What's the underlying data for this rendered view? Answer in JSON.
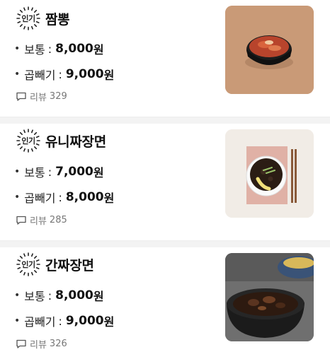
{
  "items": [
    {
      "badge": "인기",
      "name": "짬뽕",
      "prices": [
        {
          "label": "보통",
          "price": "8,000",
          "unit": "원"
        },
        {
          "label": "곱빼기",
          "price": "9,000",
          "unit": "원"
        }
      ],
      "review_label": "리뷰",
      "review_count": "329",
      "image": "jjamppong-photo",
      "image_bg": "#c99a77"
    },
    {
      "badge": "인기",
      "name": "유니짜장면",
      "prices": [
        {
          "label": "보통",
          "price": "7,000",
          "unit": "원"
        },
        {
          "label": "곱빼기",
          "price": "8,000",
          "unit": "원"
        }
      ],
      "review_label": "리뷰",
      "review_count": "285",
      "image": "yuni-jjajangmyeon-photo",
      "image_bg": "#f1ece6"
    },
    {
      "badge": "인기",
      "name": "간짜장면",
      "prices": [
        {
          "label": "보통",
          "price": "8,000",
          "unit": "원"
        },
        {
          "label": "곱빼기",
          "price": "9,000",
          "unit": "원"
        }
      ],
      "review_label": "리뷰",
      "review_count": "326",
      "image": "ganjjajang-photo",
      "image_bg": "#6f6f6f"
    }
  ],
  "colon": ":",
  "bullet": "•"
}
